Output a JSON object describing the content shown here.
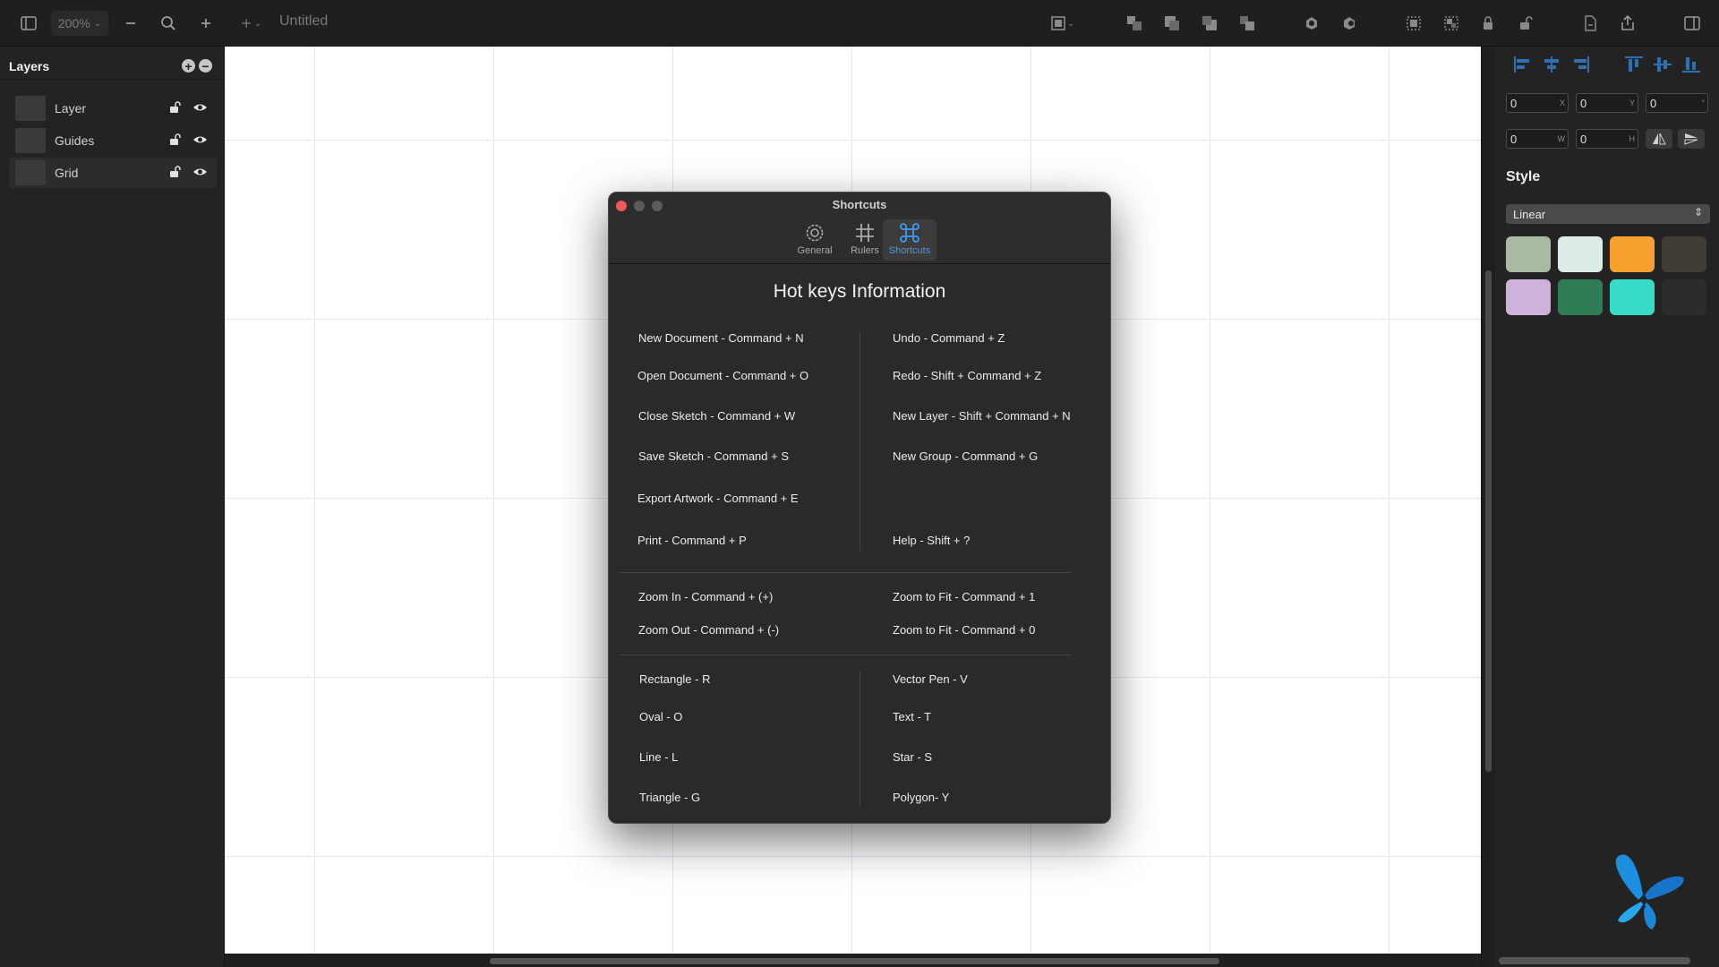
{
  "toolbar": {
    "zoom": "200%",
    "document_title": "Untitled",
    "icons": [
      "sidebar-toggle-icon",
      "zoom-out-icon",
      "magnifier-icon",
      "zoom-in-icon",
      "add-menu-icon",
      "frame-icon",
      "bring-to-front-icon",
      "bring-forward-icon",
      "send-backward-icon",
      "send-to-back-icon",
      "union-icon",
      "subtract-icon",
      "group-icon",
      "ungroup-icon",
      "lock-icon",
      "unlock-icon",
      "export-file-icon",
      "share-icon",
      "inspector-toggle-icon"
    ]
  },
  "layers_panel": {
    "title": "Layers",
    "items": [
      {
        "name": "Layer",
        "locked": false,
        "visible": true
      },
      {
        "name": "Guides",
        "locked": false,
        "visible": true
      },
      {
        "name": "Grid",
        "locked": false,
        "visible": true,
        "selected": true
      }
    ]
  },
  "dialog": {
    "title": "Shortcuts",
    "tabs": [
      {
        "label": "General",
        "icon": "gear-icon",
        "active": false
      },
      {
        "label": "Rulers",
        "icon": "grid-icon",
        "active": false
      },
      {
        "label": "Shortcuts",
        "icon": "command-icon",
        "active": true
      }
    ],
    "heading": "Hot keys Information",
    "sections": [
      {
        "left": [
          "New Document - Command + N",
          "Open Document - Command + O",
          "Close Sketch - Command + W",
          "Save Sketch - Command + S",
          "Export Artwork - Command + E",
          "Print - Command + P"
        ],
        "right": [
          "Undo - Command + Z",
          "Redo - Shift + Command + Z",
          "New Layer - Shift + Command + N",
          "New Group - Command + G",
          "",
          "Help - Shift + ?"
        ]
      },
      {
        "left": [
          "Zoom In - Command + (+)",
          "Zoom Out - Command + (-)"
        ],
        "right": [
          "Zoom to Fit - Command + 1",
          "Zoom to Fit - Command + 0"
        ]
      },
      {
        "left": [
          "Rectangle - R",
          "Oval - O",
          "Line - L",
          "Triangle - G"
        ],
        "right": [
          "Vector Pen - V",
          "Text - T",
          "Star - S",
          "Polygon- Y"
        ]
      }
    ]
  },
  "inspector": {
    "fields": [
      {
        "value": "0",
        "label": "X"
      },
      {
        "value": "0",
        "label": "Y"
      },
      {
        "value": "0",
        "label": "°"
      },
      {
        "value": "0",
        "label": "W"
      },
      {
        "value": "0",
        "label": "H"
      }
    ],
    "style_title": "Style",
    "gradient_type": "Linear",
    "swatches": [
      "#a9b9a3",
      "#dcebe4",
      "#f6a12f",
      "#3f3d35",
      "#cfb2d9",
      "#2f7c56",
      "#38dcc6",
      "#2c2c2c"
    ]
  }
}
